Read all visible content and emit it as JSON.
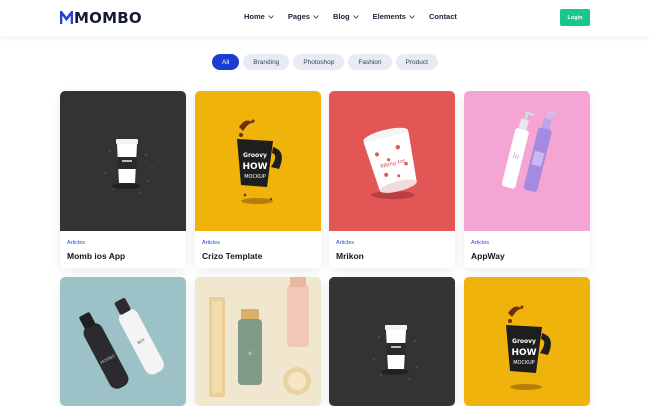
{
  "brand": {
    "name": "MOMBO"
  },
  "nav": {
    "items": [
      {
        "label": "Home",
        "dropdown": true
      },
      {
        "label": "Pages",
        "dropdown": true
      },
      {
        "label": "Blog",
        "dropdown": true
      },
      {
        "label": "Elements",
        "dropdown": true
      },
      {
        "label": "Contact",
        "dropdown": false
      }
    ],
    "login_label": "Login"
  },
  "filters": [
    "All",
    "Branding",
    "Photoshop",
    "Fashion",
    "Product"
  ],
  "active_filter": "All",
  "portfolio": [
    {
      "category": "Articles",
      "title": "Momb ios App",
      "image": "coffee-cup-mockup",
      "bg": "#333333"
    },
    {
      "category": "Articles",
      "title": "Crizo Template",
      "image": "splashing-mug-mockup",
      "bg": "#efb30c"
    },
    {
      "category": "Articles",
      "title": "Mrikon",
      "image": "ice-cream-tub-mockup",
      "bg": "#e25656"
    },
    {
      "category": "Articles",
      "title": "AppWay",
      "image": "pump-bottles-mockup",
      "bg": "#f4a5d3"
    },
    {
      "category": "",
      "title": "",
      "image": "water-bottles-mockup",
      "bg": "#9cc2c8"
    },
    {
      "category": "",
      "title": "",
      "image": "cosmetics-set-mockup",
      "bg": "#f1e7cf"
    },
    {
      "category": "",
      "title": "",
      "image": "coffee-cup-mockup",
      "bg": "#333333"
    },
    {
      "category": "",
      "title": "",
      "image": "splashing-mug-mockup",
      "bg": "#efb30c"
    }
  ],
  "colors": {
    "accent": "#1c3cd6",
    "login": "#19c788",
    "category_text": "#2449d8"
  }
}
